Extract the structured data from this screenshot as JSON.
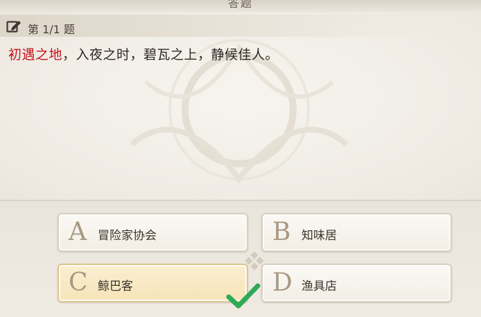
{
  "window": {
    "title": "答题"
  },
  "question": {
    "number_label": "第 1/1 题",
    "highlight": "初遇之地",
    "text": "，入夜之时，碧瓦之上，静候佳人。"
  },
  "options": [
    {
      "letter": "A",
      "text": "冒险家协会",
      "selected": false
    },
    {
      "letter": "B",
      "text": "知味居",
      "selected": false
    },
    {
      "letter": "C",
      "text": "鲸巴客",
      "selected": true
    },
    {
      "letter": "D",
      "text": "渔具店",
      "selected": false
    }
  ],
  "icons": {
    "question": "edit-icon",
    "answer_mark": "check-icon",
    "divider": "diamond-icon"
  },
  "colors": {
    "highlight": "#c8111d",
    "check": "#2faa57",
    "selected_bg": "#f6e3b8"
  }
}
